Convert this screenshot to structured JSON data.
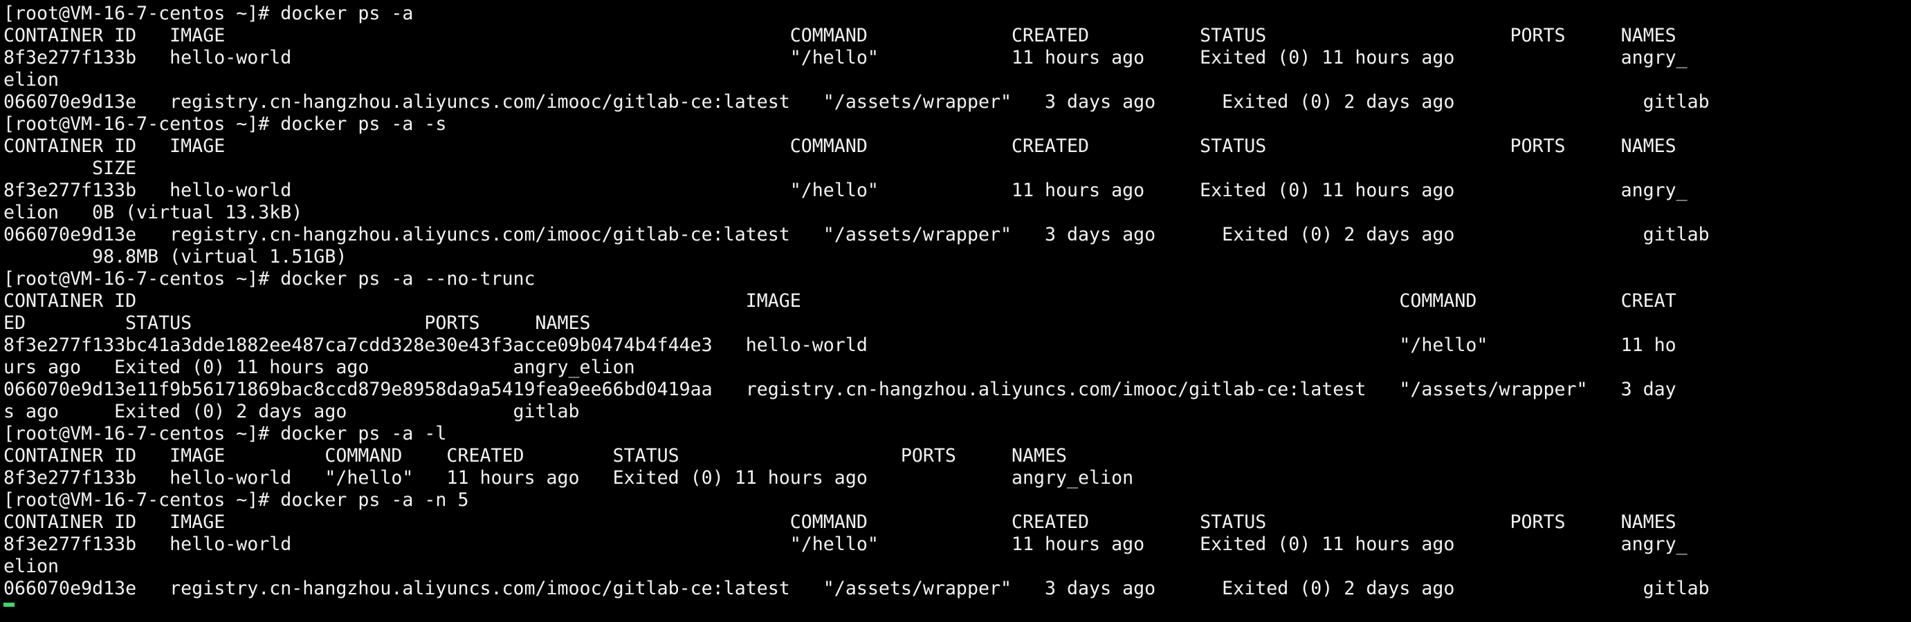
{
  "terminal": {
    "lines": [
      "[root@VM-16-7-centos ~]# docker ps -a",
      "CONTAINER ID   IMAGE                                                   COMMAND             CREATED          STATUS                      PORTS     NAMES",
      "8f3e277f133b   hello-world                                             \"/hello\"            11 hours ago     Exited (0) 11 hours ago               angry_",
      "elion",
      "066070e9d13e   registry.cn-hangzhou.aliyuncs.com/imooc/gitlab-ce:latest   \"/assets/wrapper\"   3 days ago      Exited (0) 2 days ago                 gitlab",
      "[root@VM-16-7-centos ~]# docker ps -a -s",
      "CONTAINER ID   IMAGE                                                   COMMAND             CREATED          STATUS                      PORTS     NAMES",
      "        SIZE",
      "8f3e277f133b   hello-world                                             \"/hello\"            11 hours ago     Exited (0) 11 hours ago               angry_",
      "elion   0B (virtual 13.3kB)",
      "066070e9d13e   registry.cn-hangzhou.aliyuncs.com/imooc/gitlab-ce:latest   \"/assets/wrapper\"   3 days ago      Exited (0) 2 days ago                 gitlab",
      "        98.8MB (virtual 1.51GB)",
      "[root@VM-16-7-centos ~]# docker ps -a --no-trunc",
      "CONTAINER ID                                                       IMAGE                                                      COMMAND             CREAT",
      "ED         STATUS                     PORTS     NAMES",
      "8f3e277f133bc41a3dde1882ee487ca7cdd328e30e43f3acce09b0474b4f44e3   hello-world                                                \"/hello\"            11 ho",
      "urs ago   Exited (0) 11 hours ago             angry_elion",
      "066070e9d13e11f9b56171869bac8ccd879e8958da9a5419fea9ee66bd0419aa   registry.cn-hangzhou.aliyuncs.com/imooc/gitlab-ce:latest   \"/assets/wrapper\"   3 day",
      "s ago     Exited (0) 2 days ago               gitlab",
      "[root@VM-16-7-centos ~]# docker ps -a -l",
      "CONTAINER ID   IMAGE         COMMAND    CREATED        STATUS                    PORTS     NAMES",
      "8f3e277f133b   hello-world   \"/hello\"   11 hours ago   Exited (0) 11 hours ago             angry_elion",
      "[root@VM-16-7-centos ~]# docker ps -a -n 5",
      "CONTAINER ID   IMAGE                                                   COMMAND             CREATED          STATUS                      PORTS     NAMES",
      "8f3e277f133b   hello-world                                             \"/hello\"            11 hours ago     Exited (0) 11 hours ago               angry_",
      "elion",
      "066070e9d13e   registry.cn-hangzhou.aliyuncs.com/imooc/gitlab-ce:latest   \"/assets/wrapper\"   3 days ago      Exited (0) 2 days ago                 gitlab"
    ],
    "colors": {
      "background": "#000000",
      "foreground": "#f2f2f2",
      "cursor": "#38d86b"
    }
  }
}
